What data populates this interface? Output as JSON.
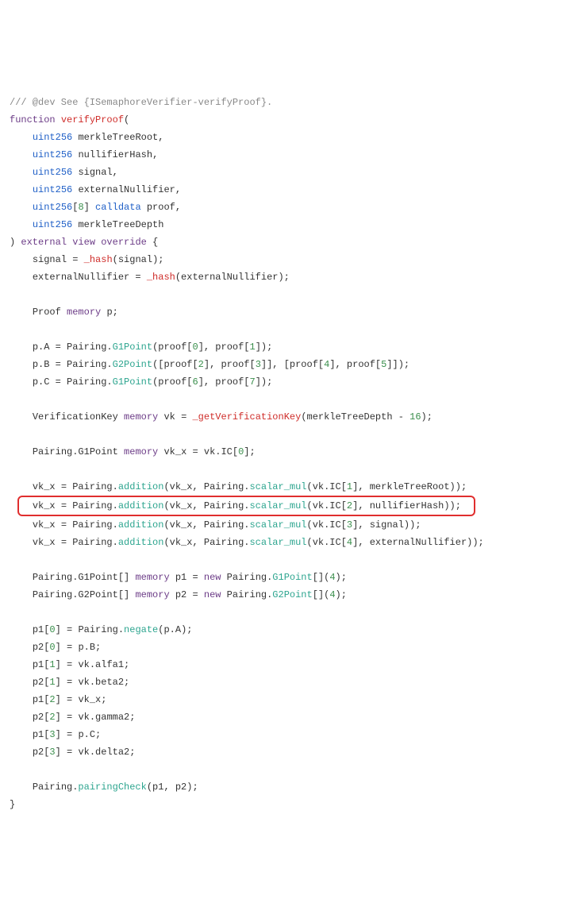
{
  "c1": "/// @dev See {ISemaphoreVerifier-verifyProof}.",
  "kw_function": "function",
  "fn_name": "verifyProof",
  "lparen": "(",
  "rparen": ")",
  "t_uint": "uint256",
  "arr8": "8",
  "t_calldata": "calldata",
  "p1": "merkleTreeRoot",
  "p2": "nullifierHash",
  "p3": "signal",
  "p4": "externalNullifier",
  "p5": "proof",
  "p6": "merkleTreeDepth",
  "comma": ",",
  "kw_external": "external",
  "kw_view": "view",
  "kw_override": "override",
  "lbrace": "{",
  "rbrace": "}",
  "eq": " = ",
  "fn_hash": "_hash",
  "l3a": "signal",
  "l3b": "(signal);",
  "l4a": "externalNullifier",
  "l4b": "(externalNullifier);",
  "Proof": "Proof",
  "kw_memory": "memory",
  "p_var": "p;",
  "pA": "p.A = Pairing.",
  "pB": "p.B = Pairing.",
  "pC": "p.C = Pairing.",
  "G1Point": "G1Point",
  "G2Point": "G2Point",
  "pa_args_open": "(proof[",
  "n0": "0",
  "n1": "1",
  "n2": "2",
  "n3": "3",
  "n4": "4",
  "n5": "5",
  "n6": "6",
  "n7": "7",
  "sep_proof": "], proof[",
  "close_sc": "]);",
  "pb_mid1": "([proof[",
  "pb_mid2": "]], [proof[",
  "pb_close": "]]);",
  "vk_decl_a": "VerificationKey",
  "vk_decl_b": "vk",
  "fn_getvk": "_getVerificationKey",
  "vk_args_a": "(merkleTreeDepth - ",
  "n16": "16",
  "vk_args_b": ");",
  "g1p_pair": "Pairing.G1Point",
  "vkx_decl": "vk_x = vk.IC[",
  "close_br_sc": "];",
  "line_pre": "vk_x = Pairing.",
  "addition": "addition",
  "scalar_mul": "scalar_mul",
  "sm_open": "(vk_x, Pairing.",
  "sm_args_open": "(vk.IC[",
  "sm_arg1": "], merkleTreeRoot));",
  "sm_arg2": "], nullifierHash));",
  "sm_arg3": "], signal));",
  "sm_arg4": "], externalNullifier));",
  "arr_decl1a": "Pairing.G1Point[]",
  "arr_decl2a": "Pairing.G2Point[]",
  "arr_p1": "p1 = ",
  "arr_p2": "p2 = ",
  "kw_new": "new",
  "arr_tail": "[](",
  "arr_close": ");",
  "as_p1_0": "p1[",
  "as_p2_0": "p2[",
  "as_mid": "] = ",
  "negate": "negate",
  "neg_arg": "(p.A);",
  "v_pB": "p.B;",
  "v_alfa1": "vk.alfa1;",
  "v_beta2": "vk.beta2;",
  "v_vkx": "vk_x;",
  "v_gamma2": "vk.gamma2;",
  "v_pC": "p.C;",
  "v_delta2": "vk.delta2;",
  "pair_pre": "Pairing.",
  "pairingCheck": "pairingCheck",
  "pair_args": "(p1, p2);"
}
